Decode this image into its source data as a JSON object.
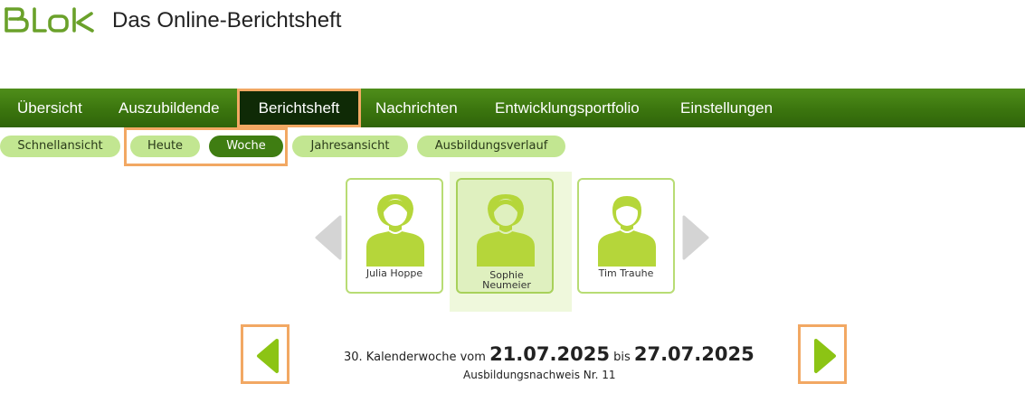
{
  "header": {
    "logo_text": "BLok",
    "title": "Das Online-Berichtsheft"
  },
  "main_nav": [
    {
      "label": "Übersicht",
      "active": false
    },
    {
      "label": "Auszubildende",
      "active": false
    },
    {
      "label": "Berichtsheft",
      "active": true
    },
    {
      "label": "Nachrichten",
      "active": false
    },
    {
      "label": "Entwicklungsportfolio",
      "active": false
    },
    {
      "label": "Einstellungen",
      "active": false
    }
  ],
  "sub_nav": [
    {
      "label": "Schnellansicht",
      "active": false
    },
    {
      "label": "Heute",
      "active": false
    },
    {
      "label": "Woche",
      "active": true
    },
    {
      "label": "Jahresansicht",
      "active": false
    },
    {
      "label": "Ausbildungsverlauf",
      "active": false
    }
  ],
  "trainees": [
    {
      "name": "Julia Hoppe",
      "avatar": "female-avatar-icon",
      "selected": false
    },
    {
      "name": "Sophie Neumeier",
      "avatar": "female-avatar-icon",
      "selected": true
    },
    {
      "name": "Tim Trauhe",
      "avatar": "male-avatar-icon",
      "selected": false
    }
  ],
  "week": {
    "prefix": "30. Kalenderwoche vom",
    "start": "21.07.2025",
    "middle": "bis",
    "end": "27.07.2025",
    "nachweis": "Ausbildungsnachweis Nr. 11"
  },
  "colors": {
    "nav_green": "#3b750e",
    "pill_green": "#c2e691",
    "pill_active": "#3f7d12",
    "avatar_green": "#b5d63a",
    "highlight_orange": "#f2a863"
  }
}
